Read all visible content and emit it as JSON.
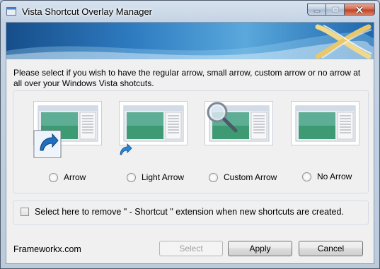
{
  "window": {
    "title": "Vista Shortcut Overlay Manager",
    "controls": [
      "minimize-icon",
      "maximize-icon",
      "close-icon"
    ]
  },
  "instructions": "Please select if you wish to have the regular arrow, small arrow, custom arrow or no arrow at all over your Windows Vista shotcuts.",
  "options": [
    {
      "label": "Arrow",
      "overlay": "arrow-icon",
      "selected": false
    },
    {
      "label": "Light Arrow",
      "overlay": "light-arrow-icon",
      "selected": false
    },
    {
      "label": "Custom Arrow",
      "overlay": "magnifier-icon",
      "selected": false
    },
    {
      "label": "No Arrow",
      "overlay": "none",
      "selected": false
    }
  ],
  "remove_extension": {
    "label": "Select here to remove \" - Shortcut \" extension when new shortcuts are created.",
    "checked": false
  },
  "footer": {
    "brand": "Frameworkx.com",
    "select_label": "Select",
    "apply_label": "Apply",
    "cancel_label": "Cancel"
  },
  "colors": {
    "banner_blue": "#2f7cc1",
    "banner_logo": "#e8c86a",
    "arrow_blue": "#1f6fc0"
  }
}
